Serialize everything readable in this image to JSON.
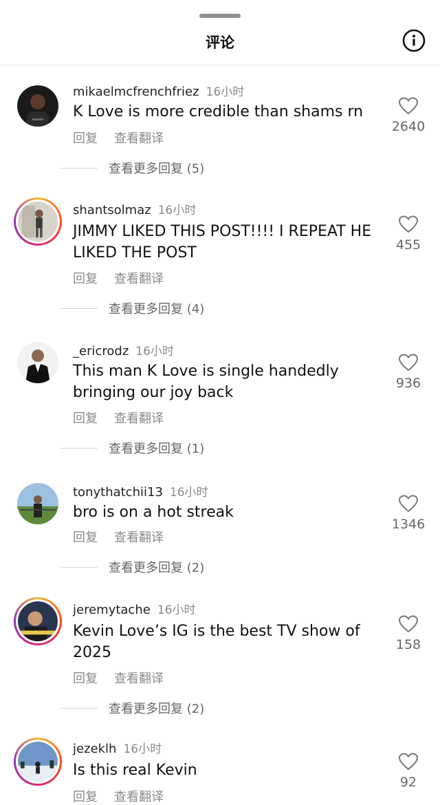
{
  "header": {
    "title": "评论",
    "info_icon": "info-icon"
  },
  "labels": {
    "reply": "回复",
    "translate": "查看翻译"
  },
  "comments": [
    {
      "username": "mikaelmcfrenchfriez",
      "time": "16小时",
      "text": "K Love is more credible than shams rn",
      "likes": "2640",
      "more_replies": "查看更多回复 (5)",
      "story_ring": false
    },
    {
      "username": "shantsolmaz",
      "time": "16小时",
      "text": "JIMMY LIKED THIS POST!!!! I REPEAT HE LIKED THE POST",
      "likes": "455",
      "more_replies": "查看更多回复 (4)",
      "story_ring": true
    },
    {
      "username": "_ericrodz",
      "time": "16小时",
      "text": "This man K Love is single handedly bringing our joy back",
      "likes": "936",
      "more_replies": "查看更多回复 (1)",
      "story_ring": false
    },
    {
      "username": "tonythatchii13",
      "time": "16小时",
      "text": "bro is on a hot streak",
      "likes": "1346",
      "more_replies": "查看更多回复 (2)",
      "story_ring": false
    },
    {
      "username": "jeremytache",
      "time": "16小时",
      "text": "Kevin Love’s IG is the best TV show of 2025",
      "likes": "158",
      "more_replies": "查看更多回复 (2)",
      "story_ring": true
    },
    {
      "username": "jezeklh",
      "time": "16小时",
      "text": "Is this real Kevin",
      "likes": "92",
      "more_replies": "",
      "story_ring": true
    }
  ]
}
